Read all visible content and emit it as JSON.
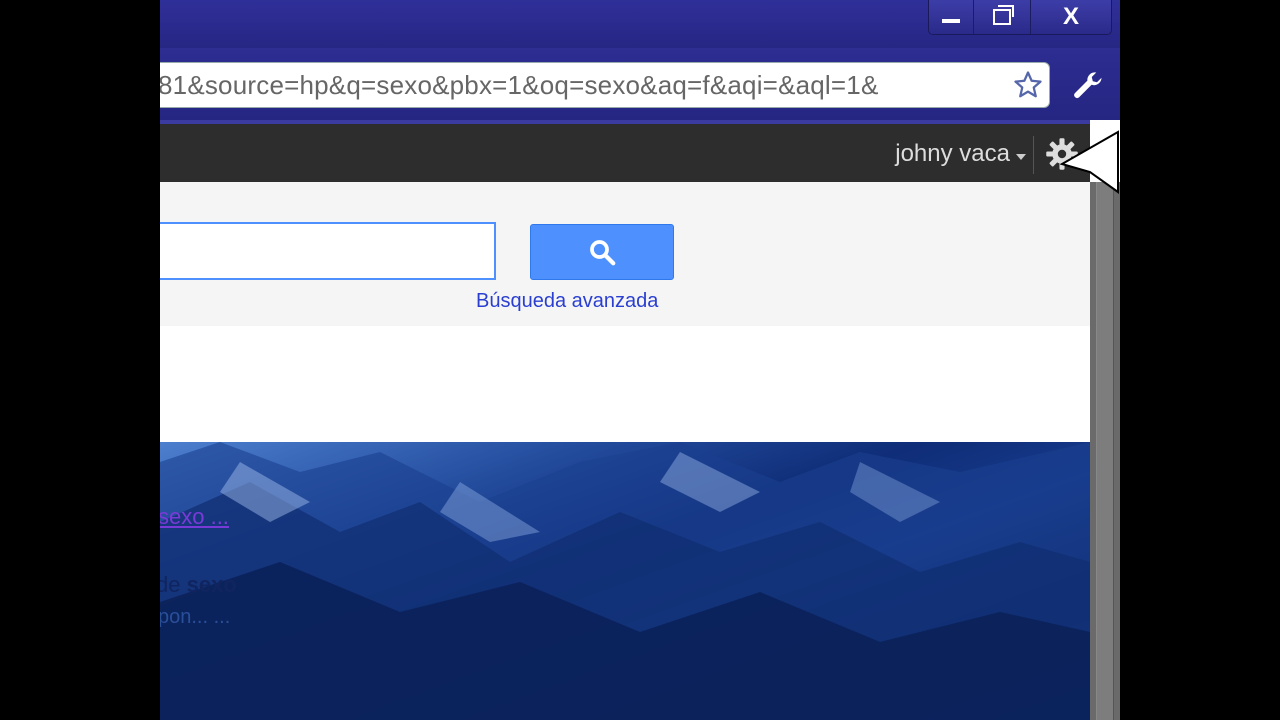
{
  "window": {
    "close_label": "X"
  },
  "toolbar": {
    "url": "81&source=hp&q=sexo&pbx=1&oq=sexo&aq=f&aqi=&aql=1&"
  },
  "google_bar": {
    "user_name": "johny vaca"
  },
  "search": {
    "input_value": "",
    "advanced_label": "Búsqueda avanzada"
  },
  "result": {
    "link_text": "sexo ...",
    "snippet_prefix": "de",
    "snippet_term": "sexo",
    "sub_text": "pon... ..."
  },
  "colors": {
    "chrome_frame": "#2a2a8a",
    "google_bar": "#2d2d2d",
    "search_button": "#4d90fe",
    "link_blue": "#2a3fd1"
  },
  "icons": [
    "minimize-icon",
    "restore-icon",
    "close-icon",
    "star-icon",
    "wrench-icon",
    "gear-icon",
    "search-icon",
    "cursor-icon"
  ]
}
